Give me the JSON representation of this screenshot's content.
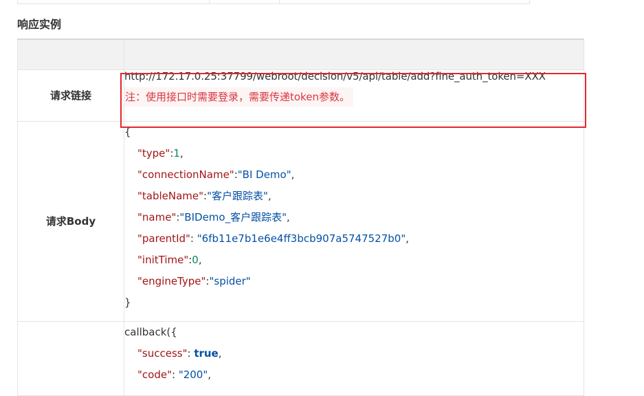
{
  "section_title": "响应实例",
  "request_link": {
    "label": "请求链接",
    "url": "http://172.17.0.25:37799/webroot/decision/v5/api/table/add?fine_auth_token=XXX",
    "note": "注：使用接口时需要登录，需要传递token参数。"
  },
  "request_body": {
    "label": "请求Body",
    "open_brace": "{",
    "close_brace": "}",
    "fields": [
      {
        "key": "\"type\"",
        "sep": ":",
        "value": "1",
        "vtype": "n",
        "tail": ","
      },
      {
        "key": "\"connectionName\"",
        "sep": ":",
        "value": "\"BI Demo\"",
        "vtype": "s",
        "tail": ","
      },
      {
        "key": "\"tableName\"",
        "sep": ":",
        "value": "\"客户跟踪表\"",
        "vtype": "s",
        "tail": ","
      },
      {
        "key": "\"name\"",
        "sep": ":",
        "value": "\"BIDemo_客户跟踪表\"",
        "vtype": "s",
        "tail": ","
      },
      {
        "key": "\"parentId\"",
        "sep": ": ",
        "value": "\"6fb11e7b1e6e4ff3bcb907a5747527b0\"",
        "vtype": "s",
        "tail": ","
      },
      {
        "key": "\"initTime\"",
        "sep": ":",
        "value": "0",
        "vtype": "n",
        "tail": ","
      },
      {
        "key": "\"engineType\"",
        "sep": ":",
        "value": "\"spider\"",
        "vtype": "s",
        "tail": ""
      }
    ]
  },
  "response": {
    "open": "callback({",
    "fields": [
      {
        "key": "\"success\"",
        "sep": ": ",
        "value": "true",
        "vtype": "b",
        "tail": ","
      },
      {
        "key": "\"code\"",
        "sep": ": ",
        "value": "\"200\"",
        "vtype": "s",
        "tail": ","
      }
    ]
  },
  "colors": {
    "highlight_border": "#e0272d",
    "note_text": "#d9363e",
    "json_key": "#a31515",
    "json_string": "#0451a5",
    "json_number": "#098658"
  }
}
